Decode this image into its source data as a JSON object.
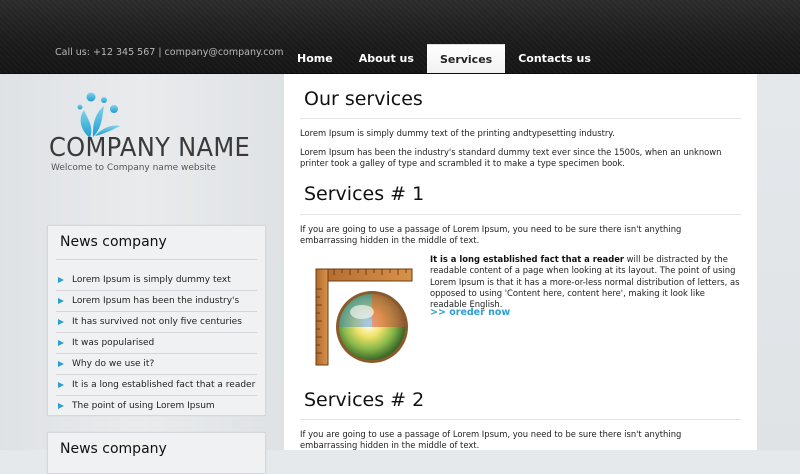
{
  "header": {
    "contact": "Call us: +12 345 567 | company@company.com",
    "nav": [
      {
        "label": "Home",
        "active": false
      },
      {
        "label": "About us",
        "active": false
      },
      {
        "label": "Services",
        "active": true
      },
      {
        "label": "Contacts us",
        "active": false
      }
    ]
  },
  "brand": {
    "name": "COMPANY NAME",
    "tagline": "Welcome to Company name  website",
    "logo_icon": "water-splash-icon",
    "accent_color": "#2d9fd0"
  },
  "sidebar": {
    "news_boxes": [
      {
        "title": "News company",
        "items": [
          "Lorem Ipsum is simply dummy text",
          "Lorem Ipsum has been the industry's",
          "It has survived not only five centuries",
          "It was popularised",
          "Why do we use it?",
          "It is a long established fact that a reader",
          "The point of using Lorem Ipsum"
        ]
      },
      {
        "title": "News company",
        "items": []
      }
    ]
  },
  "main": {
    "page_title": "Our services",
    "intro_1": "Lorem Ipsum is simply dummy text of the printing andtypesetting industry.",
    "intro_2": "Lorem Ipsum has been the industry's standard dummy text ever since the 1500s, when an unknown printer took a galley of type and scrambled it to make a type specimen book.",
    "services": [
      {
        "title": "Services # 1",
        "text": "If you are going to use a passage of Lorem Ipsum, you need to be sure there isn't anything embarrassing hidden in the middle of text.",
        "feature_bold": "It is a long established fact that a reader",
        "feature_text": " will be distracted by the readable content of a page when looking at its layout. The point of using Lorem Ipsum is that it has a more-or-less normal distribution of letters, as opposed to using 'Content here, content here', making it look like readable English.",
        "link": ">> oreder now",
        "image_icon": "ruler-sphere-icon"
      },
      {
        "title": "Services # 2",
        "text": "If you are going to use a passage of Lorem Ipsum, you need to be sure there isn't anything embarrassing hidden in the middle of text."
      }
    ]
  }
}
